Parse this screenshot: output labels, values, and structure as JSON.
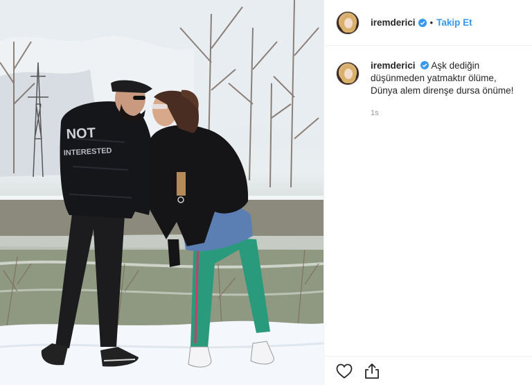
{
  "header": {
    "username": "iremderici",
    "separator": "•",
    "follow_label": "Takip Et"
  },
  "caption": {
    "username": "iremderici",
    "text": "Aşk dediğin düşünmeden yatmaktır ölüme, Dünya alem direnşe dursa önüme!",
    "time": "1s"
  },
  "photo": {
    "jacket_print": [
      "NOT",
      "INTERESTED"
    ]
  },
  "icons": {
    "verified": "verified-badge-icon",
    "like": "heart-icon",
    "share": "share-icon"
  },
  "colors": {
    "accent": "#3897f0",
    "text": "#262626",
    "muted": "#999999",
    "border": "#efefef"
  }
}
